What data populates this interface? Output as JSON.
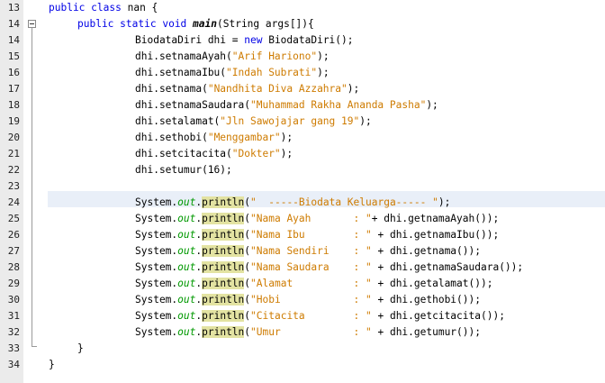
{
  "editor": {
    "lines": [
      {
        "num": "13",
        "indent": 0,
        "tokens": [
          {
            "t": "public",
            "c": "kw"
          },
          {
            "t": " "
          },
          {
            "t": "class",
            "c": "kw"
          },
          {
            "t": " nan {"
          }
        ]
      },
      {
        "num": "14",
        "indent": 1,
        "tokens": [
          {
            "t": "public",
            "c": "kw"
          },
          {
            "t": " "
          },
          {
            "t": "static",
            "c": "kw"
          },
          {
            "t": " "
          },
          {
            "t": "void",
            "c": "kw"
          },
          {
            "t": " "
          },
          {
            "t": "main",
            "c": "mth"
          },
          {
            "t": "(String args[]){"
          }
        ]
      },
      {
        "num": "14",
        "indent": 2,
        "tokens": [
          {
            "t": "BiodataDiri dhi = "
          },
          {
            "t": "new",
            "c": "kw"
          },
          {
            "t": " BiodataDiri();"
          }
        ]
      },
      {
        "num": "15",
        "indent": 2,
        "tokens": [
          {
            "t": "dhi.setnamaAyah("
          },
          {
            "t": "\"Arif Hariono\"",
            "c": "str"
          },
          {
            "t": ");"
          }
        ]
      },
      {
        "num": "16",
        "indent": 2,
        "tokens": [
          {
            "t": "dhi.setnamaIbu("
          },
          {
            "t": "\"Indah Subrati\"",
            "c": "str"
          },
          {
            "t": ");"
          }
        ]
      },
      {
        "num": "17",
        "indent": 2,
        "tokens": [
          {
            "t": "dhi.setnama("
          },
          {
            "t": "\"Nandhita Diva Azzahra\"",
            "c": "str"
          },
          {
            "t": ");"
          }
        ]
      },
      {
        "num": "18",
        "indent": 2,
        "tokens": [
          {
            "t": "dhi.setnamaSaudara("
          },
          {
            "t": "\"Muhammad Rakha Ananda Pasha\"",
            "c": "str"
          },
          {
            "t": ");"
          }
        ]
      },
      {
        "num": "19",
        "indent": 2,
        "tokens": [
          {
            "t": "dhi.setalamat("
          },
          {
            "t": "\"Jln Sawojajar gang 19\"",
            "c": "str"
          },
          {
            "t": ");"
          }
        ]
      },
      {
        "num": "20",
        "indent": 2,
        "tokens": [
          {
            "t": "dhi.sethobi("
          },
          {
            "t": "\"Menggambar\"",
            "c": "str"
          },
          {
            "t": ");"
          }
        ]
      },
      {
        "num": "21",
        "indent": 2,
        "tokens": [
          {
            "t": "dhi.setcitacita("
          },
          {
            "t": "\"Dokter\"",
            "c": "str"
          },
          {
            "t": ");"
          }
        ]
      },
      {
        "num": "22",
        "indent": 2,
        "tokens": [
          {
            "t": "dhi.setumur(16);"
          }
        ]
      },
      {
        "num": "23",
        "indent": 2,
        "tokens": []
      },
      {
        "num": "24",
        "indent": 2,
        "tokens": [
          {
            "t": "System."
          },
          {
            "t": "out",
            "c": "fld"
          },
          {
            "t": "."
          },
          {
            "t": "println",
            "c": "pl"
          },
          {
            "t": "("
          },
          {
            "t": "\"  -----Biodata Keluarga----- \"",
            "c": "str"
          },
          {
            "t": ");"
          }
        ]
      },
      {
        "num": "25",
        "indent": 2,
        "tokens": [
          {
            "t": "System."
          },
          {
            "t": "out",
            "c": "fld"
          },
          {
            "t": "."
          },
          {
            "t": "println",
            "c": "pl"
          },
          {
            "t": "("
          },
          {
            "t": "\"Nama Ayah       : \"",
            "c": "str"
          },
          {
            "t": "+ dhi.getnamaAyah());"
          }
        ]
      },
      {
        "num": "26",
        "indent": 2,
        "tokens": [
          {
            "t": "System."
          },
          {
            "t": "out",
            "c": "fld"
          },
          {
            "t": "."
          },
          {
            "t": "println",
            "c": "pl"
          },
          {
            "t": "("
          },
          {
            "t": "\"Nama Ibu        : \"",
            "c": "str"
          },
          {
            "t": " + dhi.getnamaIbu());"
          }
        ]
      },
      {
        "num": "27",
        "indent": 2,
        "tokens": [
          {
            "t": "System."
          },
          {
            "t": "out",
            "c": "fld"
          },
          {
            "t": "."
          },
          {
            "t": "println",
            "c": "pl"
          },
          {
            "t": "("
          },
          {
            "t": "\"Nama Sendiri    : \"",
            "c": "str"
          },
          {
            "t": " + dhi.getnama());"
          }
        ]
      },
      {
        "num": "28",
        "indent": 2,
        "tokens": [
          {
            "t": "System."
          },
          {
            "t": "out",
            "c": "fld"
          },
          {
            "t": "."
          },
          {
            "t": "println",
            "c": "pl"
          },
          {
            "t": "("
          },
          {
            "t": "\"Nama Saudara    : \"",
            "c": "str"
          },
          {
            "t": " + dhi.getnamaSaudara());"
          }
        ]
      },
      {
        "num": "29",
        "indent": 2,
        "tokens": [
          {
            "t": "System."
          },
          {
            "t": "out",
            "c": "fld"
          },
          {
            "t": "."
          },
          {
            "t": "println",
            "c": "pl"
          },
          {
            "t": "("
          },
          {
            "t": "\"Alamat          : \"",
            "c": "str"
          },
          {
            "t": " + dhi.getalamat());"
          }
        ]
      },
      {
        "num": "30",
        "indent": 2,
        "tokens": [
          {
            "t": "System."
          },
          {
            "t": "out",
            "c": "fld"
          },
          {
            "t": "."
          },
          {
            "t": "println",
            "c": "pl"
          },
          {
            "t": "("
          },
          {
            "t": "\"Hobi            : \"",
            "c": "str"
          },
          {
            "t": " + dhi.gethobi());"
          }
        ]
      },
      {
        "num": "31",
        "indent": 2,
        "tokens": [
          {
            "t": "System."
          },
          {
            "t": "out",
            "c": "fld"
          },
          {
            "t": "."
          },
          {
            "t": "println",
            "c": "pl"
          },
          {
            "t": "("
          },
          {
            "t": "\"Citacita        : \"",
            "c": "str"
          },
          {
            "t": " + dhi.getcitacita());"
          }
        ]
      },
      {
        "num": "32",
        "indent": 2,
        "tokens": [
          {
            "t": "System."
          },
          {
            "t": "out",
            "c": "fld"
          },
          {
            "t": "."
          },
          {
            "t": "println",
            "c": "pl"
          },
          {
            "t": "("
          },
          {
            "t": "\"Umur            : \"",
            "c": "str"
          },
          {
            "t": " + dhi.getumur());"
          }
        ]
      },
      {
        "num": "33",
        "indent": 1,
        "tokens": [
          {
            "t": "}"
          }
        ]
      },
      {
        "num": "34",
        "indent": 0,
        "tokens": [
          {
            "t": "}"
          }
        ]
      }
    ],
    "highlighted_line": "24",
    "colors": {
      "keyword": "#0000e6",
      "string": "#ce7b00",
      "field": "#009900",
      "method_highlight": "#e3e3a2",
      "current_line": "#e9eff8",
      "gutter": "#ebebeb"
    }
  }
}
